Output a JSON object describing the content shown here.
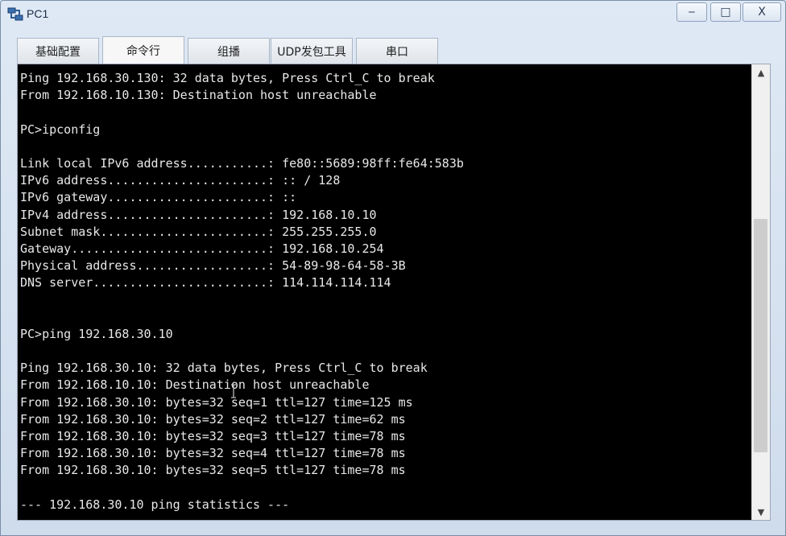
{
  "window": {
    "title": "PC1",
    "minimize_label": "‒",
    "maximize_label": "□",
    "close_label": "X"
  },
  "tabs": [
    {
      "label": "基础配置"
    },
    {
      "label": "命令行"
    },
    {
      "label": "组播"
    },
    {
      "label": "UDP发包工具"
    },
    {
      "label": "串口"
    }
  ],
  "active_tab": "命令行",
  "terminal": {
    "lines": [
      "Ping 192.168.30.130: 32 data bytes, Press Ctrl_C to break",
      "From 192.168.10.130: Destination host unreachable",
      "",
      "PC>ipconfig",
      "",
      "Link local IPv6 address...........: fe80::5689:98ff:fe64:583b",
      "IPv6 address......................: :: / 128",
      "IPv6 gateway......................: ::",
      "IPv4 address......................: 192.168.10.10",
      "Subnet mask.......................: 255.255.255.0",
      "Gateway...........................: 192.168.10.254",
      "Physical address..................: 54-89-98-64-58-3B",
      "DNS server........................: 114.114.114.114",
      "",
      "",
      "PC>ping 192.168.30.10",
      "",
      "Ping 192.168.30.10: 32 data bytes, Press Ctrl_C to break",
      "From 192.168.10.10: Destination host unreachable",
      "From 192.168.30.10: bytes=32 seq=1 ttl=127 time=125 ms",
      "From 192.168.30.10: bytes=32 seq=2 ttl=127 time=62 ms",
      "From 192.168.30.10: bytes=32 seq=3 ttl=127 time=78 ms",
      "From 192.168.30.10: bytes=32 seq=4 ttl=127 time=78 ms",
      "From 192.168.30.10: bytes=32 seq=5 ttl=127 time=78 ms",
      "",
      "--- 192.168.30.10 ping statistics ---"
    ]
  },
  "scrollbar": {
    "up_arrow": "▲",
    "down_arrow": "▼"
  },
  "colors": {
    "terminal_bg": "#000000",
    "terminal_fg": "#e8e8e8",
    "window_bg": "#d9e4f1"
  }
}
